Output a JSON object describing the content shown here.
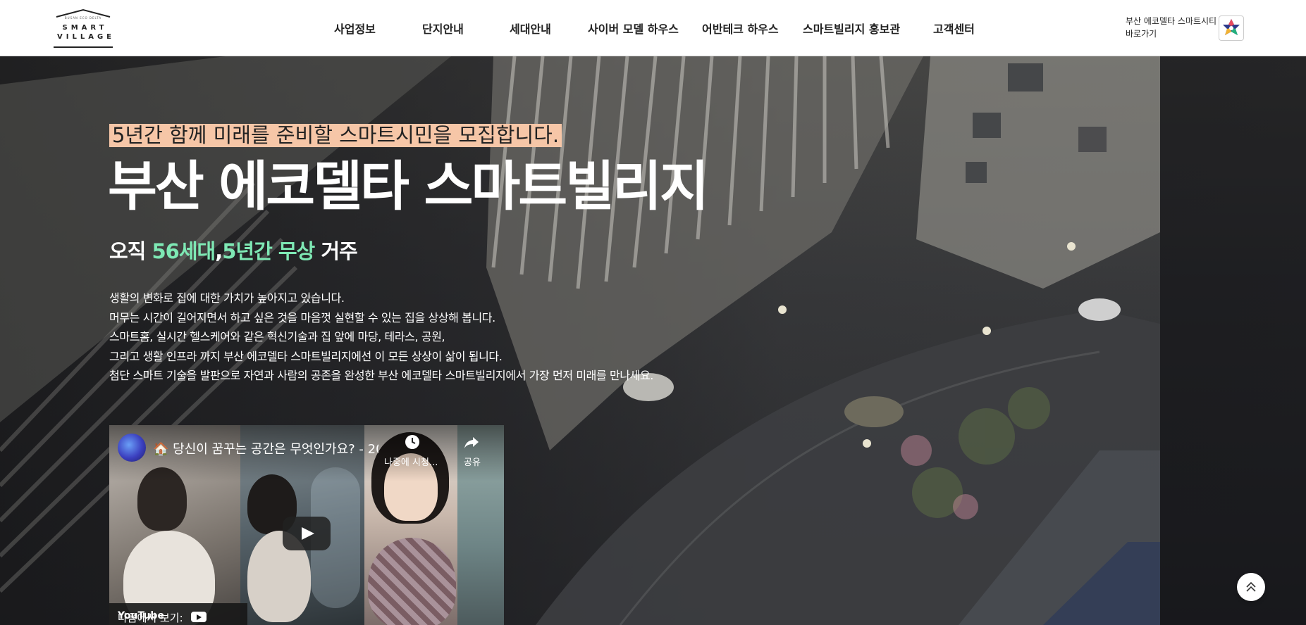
{
  "header": {
    "logo": {
      "top_text": "BUSAN ECO DELTA",
      "line1": "SMART",
      "line2": "VILLAGE"
    },
    "nav": [
      {
        "label": "사업정보"
      },
      {
        "label": "단지안내"
      },
      {
        "label": "세대안내"
      },
      {
        "label": "사이버 모델 하우스"
      },
      {
        "label": "어반테크 하우스"
      },
      {
        "label": "스마트빌리지 홍보관"
      },
      {
        "label": "고객센터"
      }
    ],
    "shortcut": {
      "line1": "부산 에코델타 스마트시티",
      "line2": "바로가기"
    }
  },
  "hero": {
    "highlight": "5년간 함께 미래를 준비할 스마트시민을 모집합니다.",
    "title": "부산 에코델타 스마트빌리지",
    "subtitle": {
      "prefix": "오직 ",
      "units": "56세대",
      "comma": ",",
      "free": "5년간 무상",
      "suffix": " 거주"
    },
    "description": [
      "생활의 변화로 집에 대한 가치가 높아지고 있습니다.",
      "머무는 시간이 길어지면서 하고 싶은 것을 마음껏 실현할 수 있는 집을 상상해 봅니다.",
      "스마트홈, 실시간 헬스케어와 같은 혁신기술과 집 앞에 마당, 테라스, 공원,",
      "그리고 생활 인프라 까지 부산 에코델타 스마트빌리지에선 이 모든 상상이 삶이 됩니다.",
      "첨단 스마트 기술을 발판으로 자연과 사람의 공존을 완성한 부산 에코델타 스마트빌리지에서 가장 먼저 미래를 만나세요."
    ]
  },
  "video": {
    "title": "🏠 당신이 꿈꾸는 공간은 무엇인가요? - 20...",
    "watch_later": "나중에 시청...",
    "share": "공유",
    "watch_on": "다음에서 보기:",
    "youtube": "YouTube"
  },
  "colors": {
    "accent_green": "#7ee8b4",
    "highlight_bg": "#f6c6a7"
  }
}
